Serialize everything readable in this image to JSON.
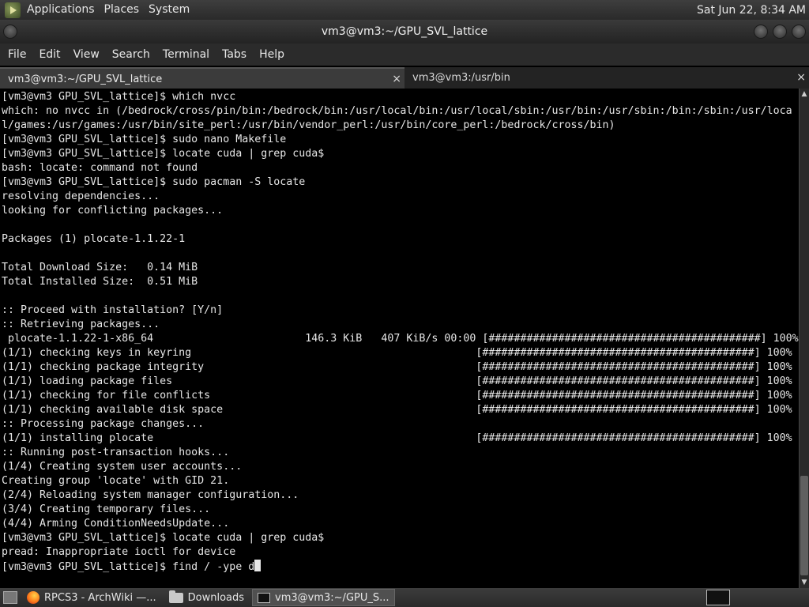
{
  "top_panel": {
    "menus": [
      "Applications",
      "Places",
      "System"
    ],
    "clock": "Sat Jun 22, 8:34 AM"
  },
  "window": {
    "title": "vm3@vm3:~/GPU_SVL_lattice"
  },
  "menubar": {
    "items": [
      "File",
      "Edit",
      "View",
      "Search",
      "Terminal",
      "Tabs",
      "Help"
    ]
  },
  "tabs": [
    {
      "label": "vm3@vm3:~/GPU_SVL_lattice",
      "close": "×",
      "active": true
    },
    {
      "label": "vm3@vm3:/usr/bin",
      "close": "×",
      "active": false
    }
  ],
  "terminal": {
    "lines": [
      "[vm3@vm3 GPU_SVL_lattice]$ which nvcc",
      "which: no nvcc in (/bedrock/cross/pin/bin:/bedrock/bin:/usr/local/bin:/usr/local/sbin:/usr/bin:/usr/sbin:/bin:/sbin:/usr/loca",
      "l/games:/usr/games:/usr/bin/site_perl:/usr/bin/vendor_perl:/usr/bin/core_perl:/bedrock/cross/bin)",
      "[vm3@vm3 GPU_SVL_lattice]$ sudo nano Makefile",
      "[vm3@vm3 GPU_SVL_lattice]$ locate cuda | grep cuda$",
      "bash: locate: command not found",
      "[vm3@vm3 GPU_SVL_lattice]$ sudo pacman -S locate",
      "resolving dependencies...",
      "looking for conflicting packages...",
      "",
      "Packages (1) plocate-1.1.22-1",
      "",
      "Total Download Size:   0.14 MiB",
      "Total Installed Size:  0.51 MiB",
      "",
      ":: Proceed with installation? [Y/n]",
      ":: Retrieving packages...",
      " plocate-1.1.22-1-x86_64                        146.3 KiB   407 KiB/s 00:00 [###########################################] 100%",
      "(1/1) checking keys in keyring                                             [###########################################] 100%",
      "(1/1) checking package integrity                                           [###########################################] 100%",
      "(1/1) loading package files                                                [###########################################] 100%",
      "(1/1) checking for file conflicts                                          [###########################################] 100%",
      "(1/1) checking available disk space                                        [###########################################] 100%",
      ":: Processing package changes...",
      "(1/1) installing plocate                                                   [###########################################] 100%",
      ":: Running post-transaction hooks...",
      "(1/4) Creating system user accounts...",
      "Creating group 'locate' with GID 21.",
      "(2/4) Reloading system manager configuration...",
      "(3/4) Creating temporary files...",
      "(4/4) Arming ConditionNeedsUpdate...",
      "[vm3@vm3 GPU_SVL_lattice]$ locate cuda | grep cuda$",
      "pread: Inappropriate ioctl for device"
    ],
    "prompt": "[vm3@vm3 GPU_SVL_lattice]$ ",
    "current_input": "find / -ype d"
  },
  "taskbar": {
    "items": [
      {
        "label": "RPCS3 - ArchWiki —...",
        "icon": "firefox-icon"
      },
      {
        "label": "Downloads",
        "icon": "folder-icon"
      },
      {
        "label": "vm3@vm3:~/GPU_S...",
        "icon": "terminal-icon",
        "active": true
      }
    ]
  }
}
